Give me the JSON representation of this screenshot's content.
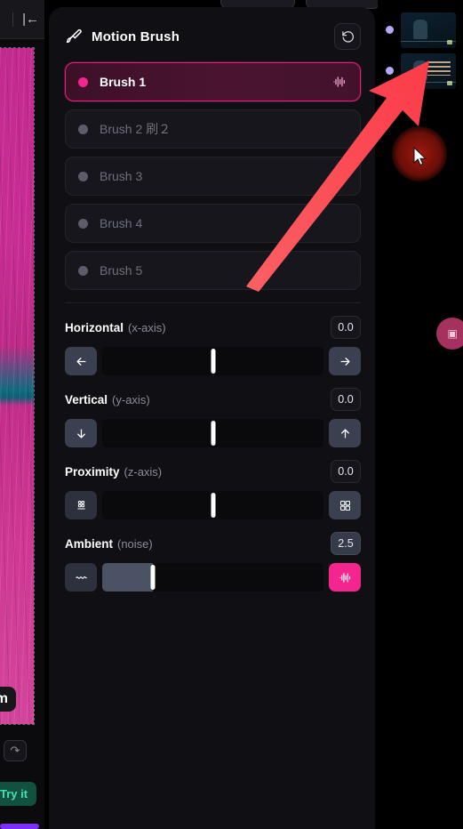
{
  "panel": {
    "title": "Motion Brush",
    "brush_icon": "paintbrush-icon",
    "reset_icon": "reset-rotate-ccw-icon",
    "brushes": [
      {
        "label": "Brush 1",
        "active": true,
        "dot_color": "#f5258f",
        "trailing_icon": "waveform-icon"
      },
      {
        "label": "Brush 2 刷２",
        "active": false,
        "dot_color": "#5c5c6b",
        "trailing_icon": ""
      },
      {
        "label": "Brush 3",
        "active": false,
        "dot_color": "#5c5c6b",
        "trailing_icon": ""
      },
      {
        "label": "Brush 4",
        "active": false,
        "dot_color": "#5c5c6b",
        "trailing_icon": ""
      },
      {
        "label": "Brush 5",
        "active": false,
        "dot_color": "#5c5c6b",
        "trailing_icon": ""
      }
    ],
    "sliders": [
      {
        "name": "Horizontal",
        "axis": "(x-axis)",
        "value": "0.0",
        "value_highlighted": false,
        "left_icon": "arrow-left-icon",
        "right_icon": "arrow-right-icon",
        "thumb_percent": 50,
        "fill_percent": 0,
        "right_button_pink": false,
        "left_button_subtle": false
      },
      {
        "name": "Vertical",
        "axis": "(y-axis)",
        "value": "0.0",
        "value_highlighted": false,
        "left_icon": "arrow-down-icon",
        "right_icon": "arrow-up-icon",
        "thumb_percent": 50,
        "fill_percent": 0,
        "right_button_pink": false,
        "left_button_subtle": false
      },
      {
        "name": "Proximity",
        "axis": "(z-axis)",
        "value": "0.0",
        "value_highlighted": false,
        "left_icon": "zoom-out-grid-icon",
        "right_icon": "zoom-in-grid-icon",
        "thumb_percent": 50,
        "fill_percent": 0,
        "right_button_pink": false,
        "left_button_subtle": true
      },
      {
        "name": "Ambient",
        "axis": "(noise)",
        "value": "2.5",
        "value_highlighted": true,
        "left_icon": "wave-line-icon",
        "right_icon": "waveform-icon",
        "thumb_percent": 23,
        "fill_percent": 23,
        "right_button_pink": true,
        "left_button_subtle": true
      }
    ]
  },
  "left_panel": {
    "collapse_icon": "collapse-panel-left-icon",
    "zoom_label": "om",
    "redo_icon": "redo-icon",
    "try_it_label": "Try it"
  },
  "rail": {
    "items": [
      {
        "name": "video-thumbnail-1"
      },
      {
        "name": "video-thumbnail-2"
      }
    ]
  },
  "colors": {
    "accent_pink": "#f5258f",
    "active_border": "#e61f7c",
    "panel_bg": "#101014",
    "row_bg": "#16161c",
    "button_blue_gray": "#3a4050",
    "annotation_red": "#fa5255",
    "teal": "#42e2b0",
    "purple": "#7b2ff7"
  }
}
